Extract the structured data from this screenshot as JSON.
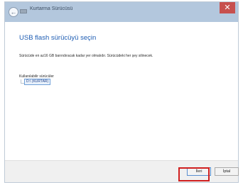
{
  "window": {
    "title": "Kurtarma Sürücüsü",
    "close_glyph": "✕",
    "back_glyph": "←"
  },
  "main": {
    "heading": "USB flash sürücüyü seçin",
    "description": "Sürücüde en az16 GB barındıracak kadar yer olmalıdır. Sürücüdeki her şey silinecek.",
    "drives_label": "Kullanılabilir sürücüler",
    "drives": [
      "D:\\ (KURTAR)"
    ]
  },
  "footer": {
    "next_label": "İleri",
    "cancel_label": "İptal"
  },
  "colors": {
    "heading": "#1e5db3",
    "titlebar": "#b3c7dd",
    "close": "#c7504e",
    "highlight": "#d01f1f"
  },
  "icons": [
    "back-icon",
    "close-icon",
    "drive-icon"
  ]
}
